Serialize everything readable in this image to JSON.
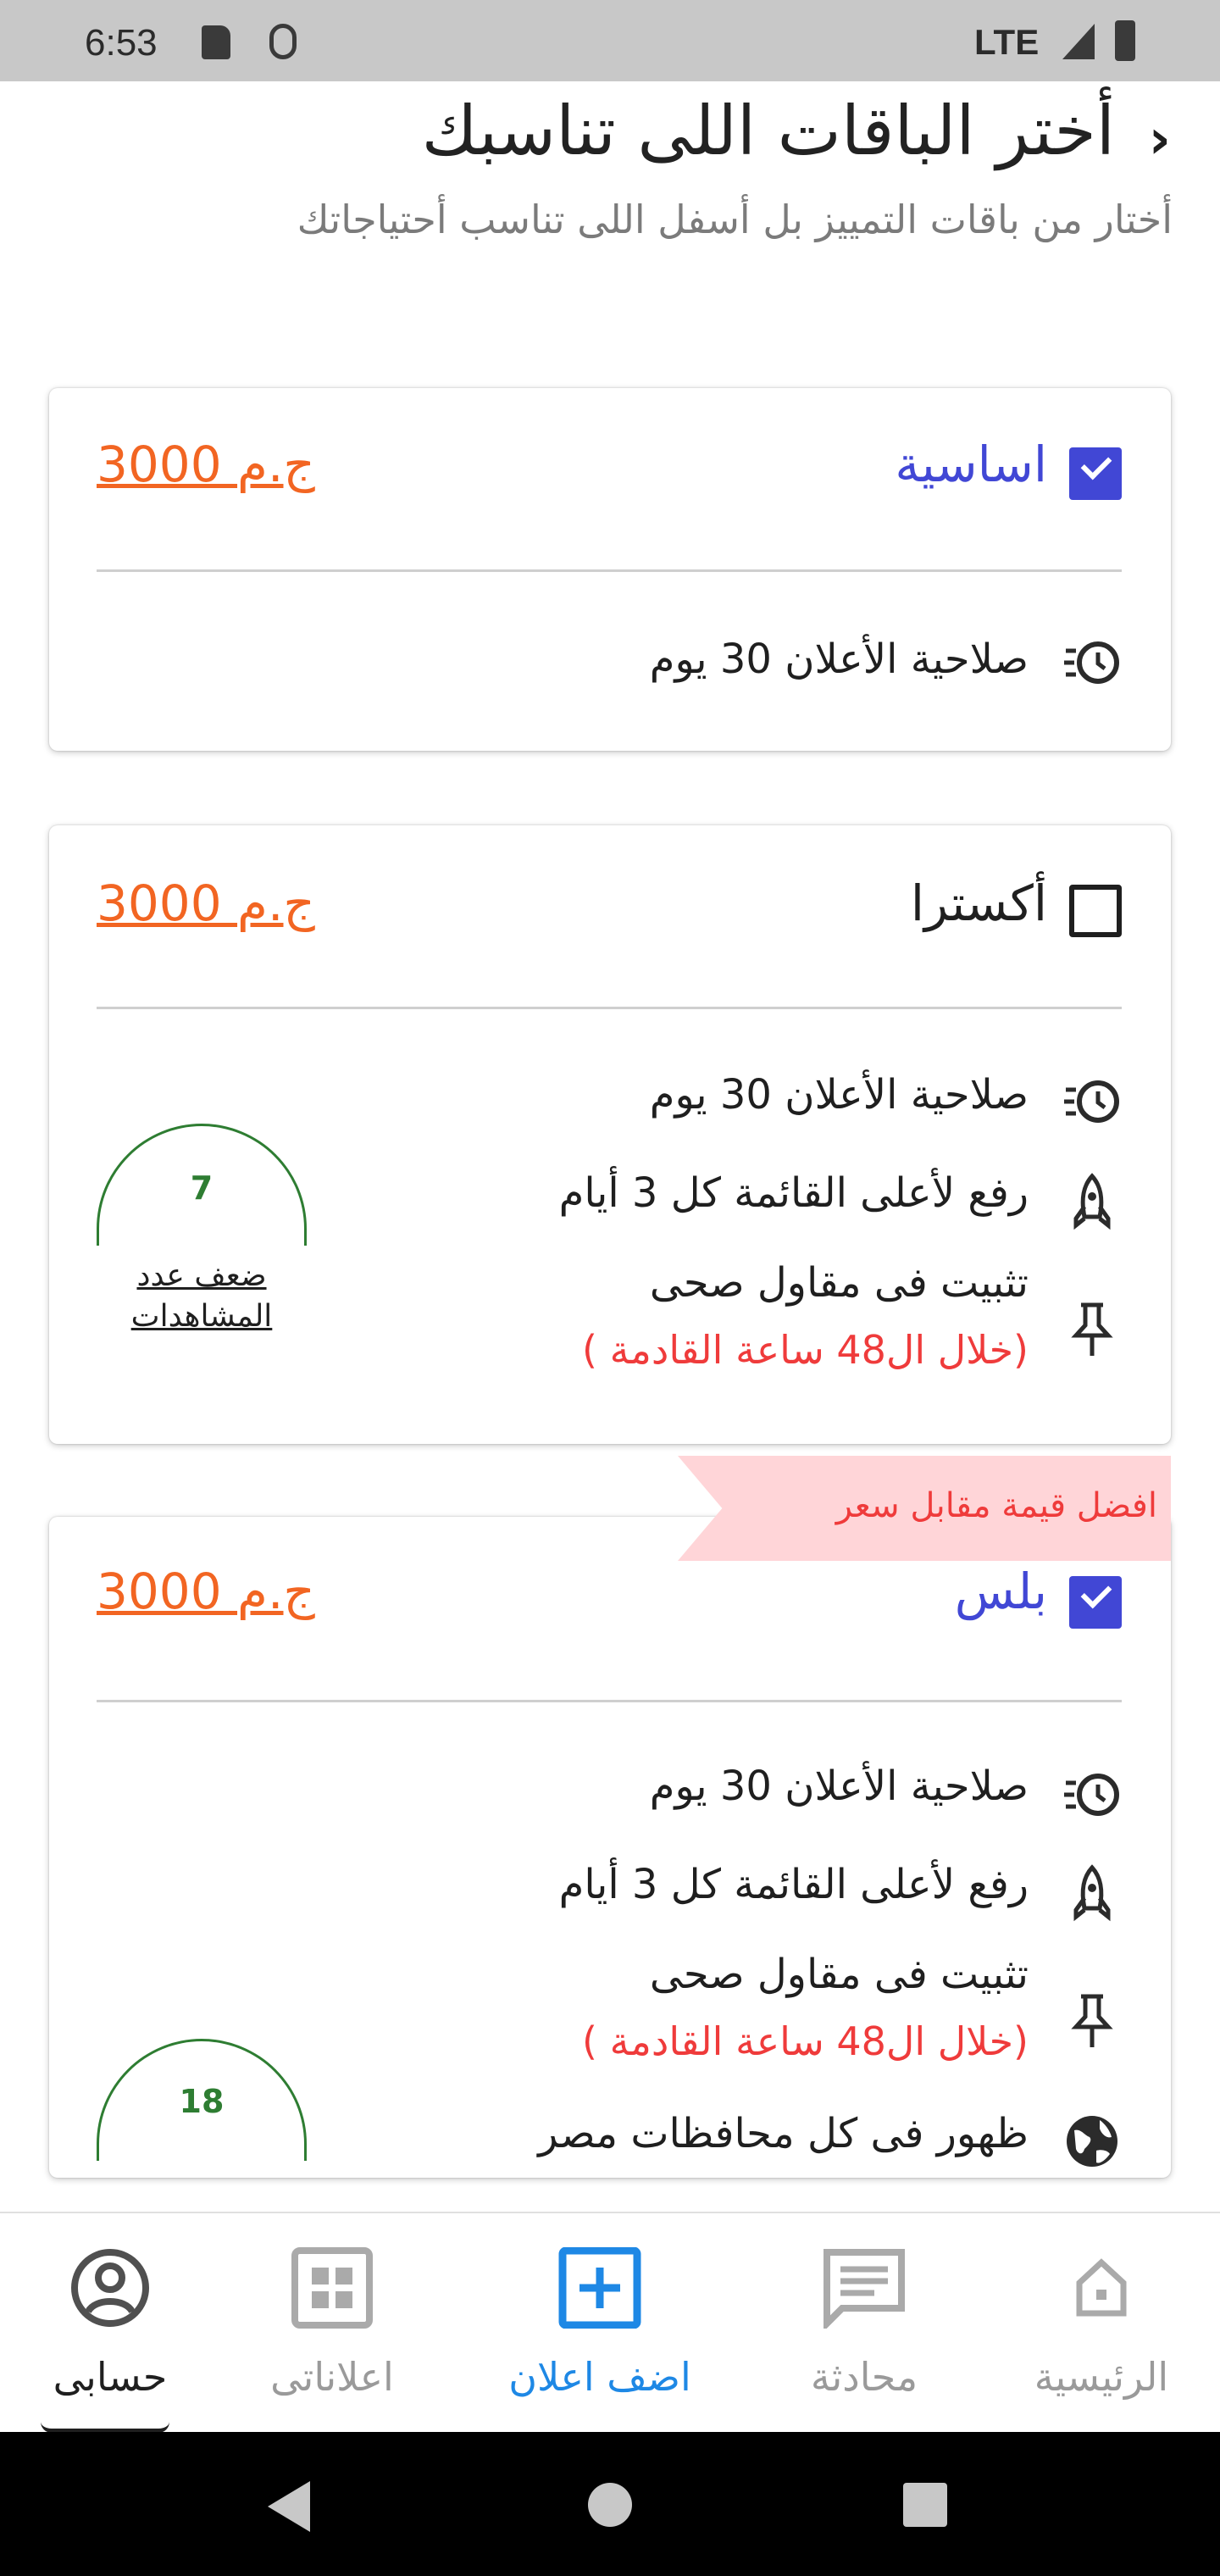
{
  "status_bar": {
    "time": "6:53",
    "network": "LTE"
  },
  "header": {
    "title": "أختر الباقات اللى تناسبك",
    "subtitle": "أختار من باقات التمييز بل أسفل اللى تناسب أحتياجاتك"
  },
  "plans": [
    {
      "name": "اساسية",
      "checked": true,
      "price": "3000 ج.م",
      "features": [
        {
          "icon": "clock-icon",
          "text": "صلاحية الأعلان 30 يوم"
        }
      ]
    },
    {
      "name": "أكسترا",
      "checked": false,
      "price": "3000 ج.م",
      "features": [
        {
          "icon": "clock-icon",
          "text": "صلاحية الأعلان 30 يوم"
        },
        {
          "icon": "rocket-icon",
          "text": "رفع لأعلى القائمة كل 3 أيام"
        },
        {
          "icon": "pin-icon",
          "text": "تثبيت فى مقاول صحى",
          "note": "(خلال ال48 ساعة القادمة )"
        }
      ],
      "views": {
        "value": "7",
        "label_line1": "ضعف عدد",
        "label_line2": "المشاهدات"
      }
    },
    {
      "name": "بلس",
      "checked": true,
      "ribbon": "افضل قيمة مقابل سعر",
      "price": "3000 ج.م",
      "features": [
        {
          "icon": "clock-icon",
          "text": "صلاحية الأعلان 30 يوم"
        },
        {
          "icon": "rocket-icon",
          "text": "رفع لأعلى القائمة كل 3 أيام"
        },
        {
          "icon": "pin-icon",
          "text": "تثبيت فى مقاول صحى",
          "note": "(خلال ال48 ساعة القادمة )"
        },
        {
          "icon": "globe-icon",
          "text": "ظهور فى كل محافظات مصر"
        }
      ],
      "views": {
        "value": "18"
      }
    }
  ],
  "bottom_nav": {
    "items": [
      {
        "label": "حسابى",
        "icon": "account-icon",
        "state": "active"
      },
      {
        "label": "اعلاناتى",
        "icon": "grid-icon",
        "state": "inactive"
      },
      {
        "label": "اضف اعلان",
        "icon": "add-box-icon",
        "state": "highlighted"
      },
      {
        "label": "محادثة",
        "icon": "chat-icon",
        "state": "inactive"
      },
      {
        "label": "الرئيسية",
        "icon": "home-icon",
        "state": "inactive"
      }
    ]
  },
  "colors": {
    "accent_blue": "#4147d5",
    "price_orange": "#f26522",
    "note_red": "#ef3b3b",
    "views_green": "#2e7d32",
    "nav_active_blue": "#1e88e5",
    "ribbon_pink": "#ffd5d8"
  }
}
